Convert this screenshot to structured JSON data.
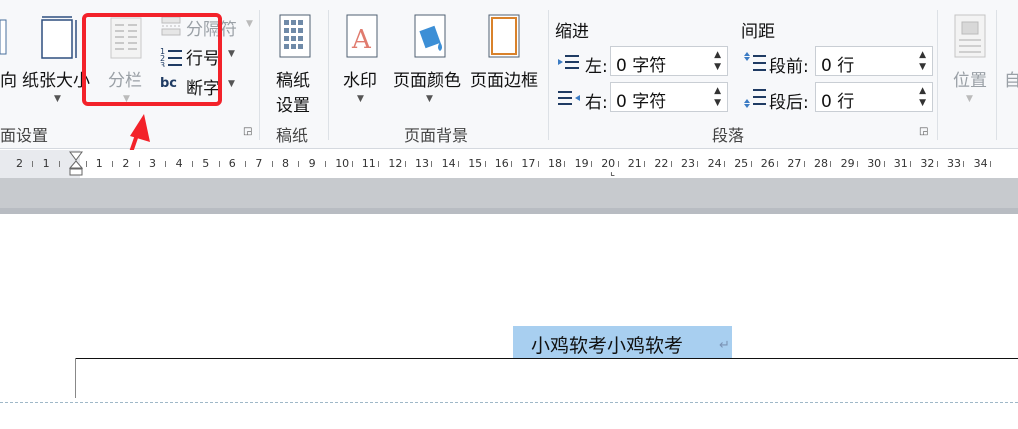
{
  "ribbon": {
    "page_setup": {
      "group_label": "面设置",
      "orientation_label": "向",
      "paper_size_label": "纸张大小",
      "columns_label": "分栏",
      "breaks_label": "分隔符",
      "line_numbers_label": "行号",
      "hyphenation_label": "断字",
      "hyphen_icon_text": "bc"
    },
    "manuscript": {
      "group_label": "稿纸",
      "button_line1": "稿纸",
      "button_line2": "设置"
    },
    "page_background": {
      "group_label": "页面背景",
      "watermark_label": "水印",
      "page_color_label": "页面颜色",
      "page_border_label": "页面边框"
    },
    "paragraph": {
      "group_label": "段落",
      "indent_title": "缩进",
      "spacing_title": "间距",
      "left_label": "左:",
      "left_value": "0 字符",
      "right_label": "右:",
      "right_value": "0 字符",
      "before_label": "段前:",
      "before_value": "0 行",
      "after_label": "段后:",
      "after_value": "0 行"
    },
    "arrange": {
      "position_label": "位置",
      "auto_label": "自"
    }
  },
  "ruler": {
    "numbers": [
      "2",
      "1",
      "",
      "1",
      "2",
      "3",
      "4",
      "5",
      "6",
      "7",
      "8",
      "9",
      "10",
      "11",
      "12",
      "13",
      "14",
      "15",
      "16",
      "17",
      "18",
      "19",
      "20",
      "21",
      "22",
      "23",
      "24",
      "25",
      "26",
      "27",
      "28",
      "29",
      "30",
      "31",
      "32",
      "33",
      "34"
    ]
  },
  "document": {
    "selected_text": "小鸡软考小鸡软考",
    "paragraph_mark": "↵"
  },
  "colors": {
    "highlight": "#a8cff0",
    "annotation_red": "#f3222a"
  }
}
